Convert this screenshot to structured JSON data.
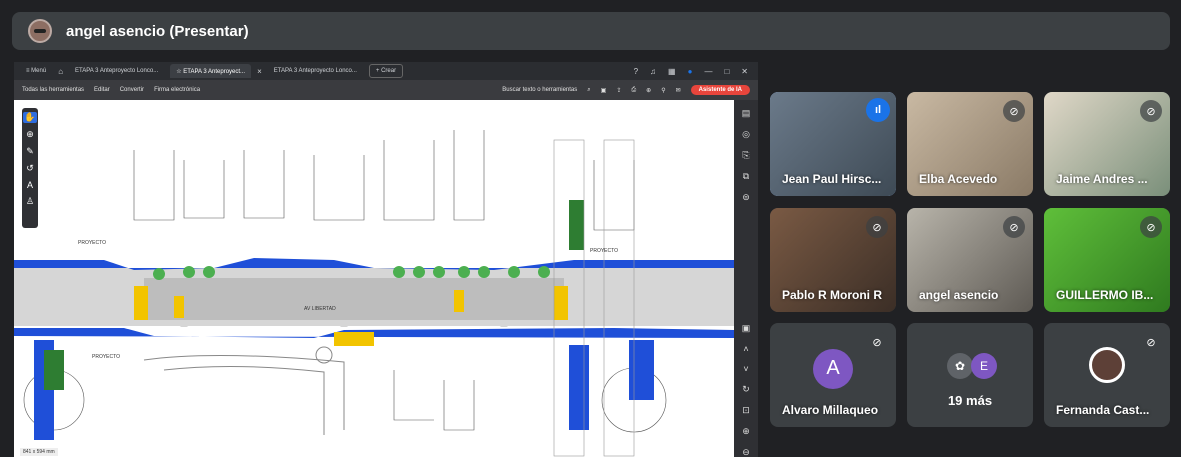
{
  "presenter": {
    "name": "angel asencio (Presentar)"
  },
  "share": {
    "tabs": [
      {
        "label": "≡ Menú"
      },
      {
        "label": "ETAPA 3 Anteproyecto Lonco..."
      },
      {
        "label": "☆ ETAPA 3 Anteproyect..."
      },
      {
        "label": "ETAPA 3 Anteproyecto Lonco..."
      },
      {
        "label": "+ Crear"
      }
    ],
    "toolbar": {
      "items": [
        "Todas las herramientas",
        "Editar",
        "Convertir",
        "Firma electrónica"
      ],
      "search": "Buscar texto o herramientas",
      "ai_button": "Asistente de IA"
    },
    "plan_labels": {
      "street": "AV LIBERTAD",
      "left_proj": "PROYECTO",
      "right_proj": "PROYECTO",
      "bottom_proj": "PROYECTO"
    },
    "statusbar": "841 x 594 mm"
  },
  "participants": [
    {
      "name": "Jean Paul Hirsc...",
      "state": "speaking"
    },
    {
      "name": "Elba Acevedo",
      "state": "muted"
    },
    {
      "name": "Jaime Andres ...",
      "state": "muted"
    },
    {
      "name": "Pablo R Moroni R",
      "state": "muted"
    },
    {
      "name": "angel asencio",
      "state": "muted"
    },
    {
      "name": "GUILLERMO IB...",
      "state": "muted"
    },
    {
      "name": "Alvaro Millaqueo",
      "initial": "A",
      "state": "muted"
    },
    {
      "name": "19 más",
      "initial": "E"
    },
    {
      "name": "Fernanda Cast...",
      "state": "muted"
    }
  ],
  "colors": {
    "bg": "#202124",
    "tile": "#3c4043",
    "accent": "#1a73e8",
    "road_blue": "#1f4fd8",
    "tree_green": "#4caf50",
    "curb_yellow": "#f2c400"
  }
}
